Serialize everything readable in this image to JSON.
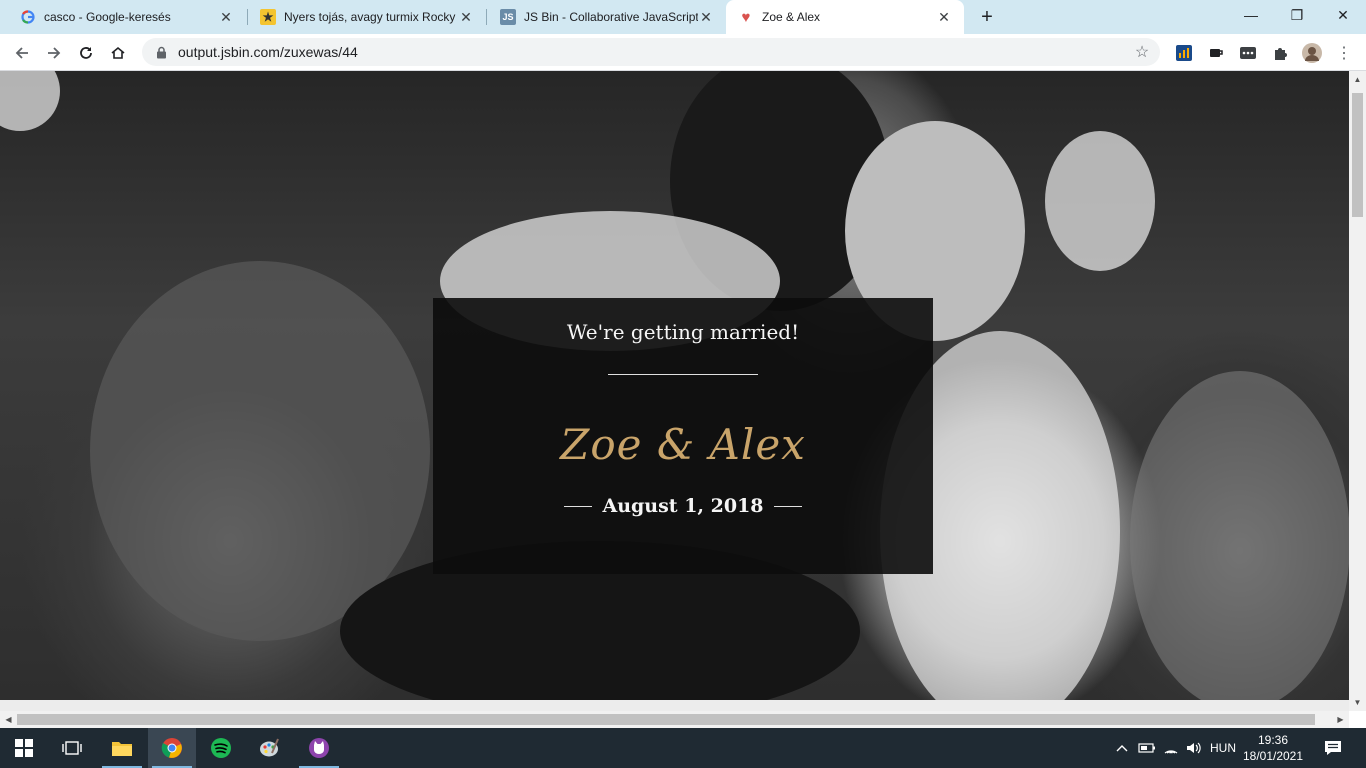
{
  "browser": {
    "tabs": [
      {
        "title": "casco - Google-keresés",
        "icon": "google-icon",
        "active": false
      },
      {
        "title": "Nyers tojás, avagy turmix Rocky Balboa módra",
        "icon": "site-icon",
        "active": false
      },
      {
        "title": "JS Bin - Collaborative JavaScript Debugging",
        "icon": "jsbin-icon",
        "active": false
      },
      {
        "title": "Zoe & Alex",
        "icon": "heart-icon",
        "active": true
      }
    ],
    "new_tab_label": "+",
    "address": "output.jsbin.com/zuxewas/44",
    "window_controls": {
      "minimize": "—",
      "restore": "❐",
      "close": "✕"
    }
  },
  "page": {
    "subtitle": "We're getting married!",
    "names": "Zoe & Alex",
    "date": "August 1, 2018"
  },
  "taskbar": {
    "language": "HUN",
    "time": "19:36",
    "date": "18/01/2021"
  },
  "colors": {
    "accent_gold": "#c9a46a",
    "tabstrip": "#d2e8f2",
    "taskbar": "#1f2a33"
  }
}
